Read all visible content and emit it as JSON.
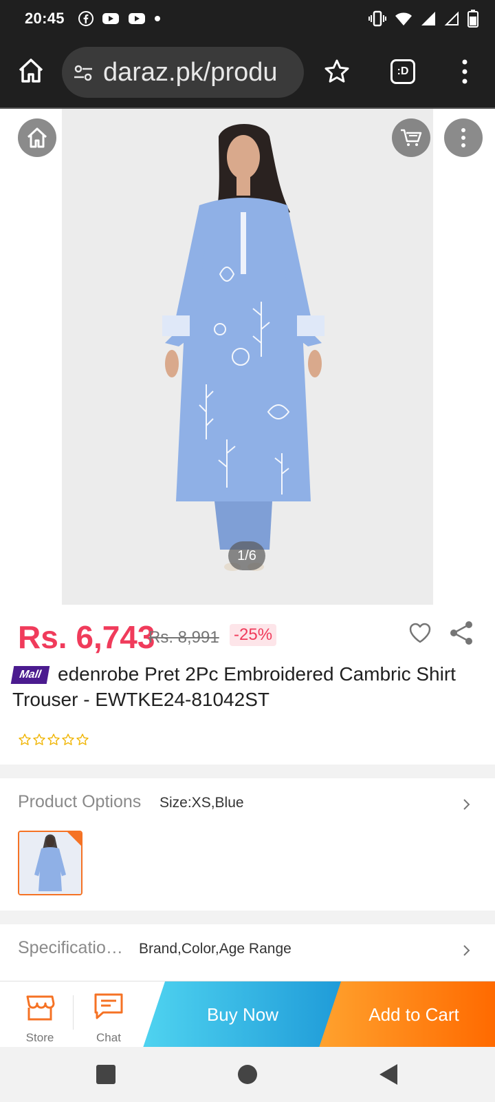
{
  "status_bar": {
    "time": "20:45",
    "left_icons": [
      "facebook-icon",
      "youtube-icon",
      "youtube-icon",
      "dot-icon"
    ],
    "right_icons": [
      "vibrate-icon",
      "wifi-icon",
      "signal-icon",
      "signal-empty-icon",
      "battery-icon"
    ]
  },
  "browser": {
    "url": "daraz.pk/produ",
    "tab_switcher_label": ":D"
  },
  "product_image": {
    "counter": "1/6",
    "colors": {
      "dress": "#8fb0e6",
      "background": "#ececec"
    }
  },
  "price": {
    "current": "Rs. 6,743",
    "original": "Rs. 8,991",
    "discount": "-25%"
  },
  "title": {
    "badge": "Mall",
    "text": "edenrobe Pret 2Pc Embroidered Cambric Shirt Trouser - EWTKE24-81042ST"
  },
  "rating": {
    "stars": 0,
    "max": 5
  },
  "options": {
    "product_options_label": "Product Options",
    "product_options_value": "Size:XS,Blue",
    "specifications_label": "Specificatio…",
    "specifications_value": "Brand,Color,Age Range"
  },
  "bottom_bar": {
    "store_label": "Store",
    "chat_label": "Chat",
    "buy_now_label": "Buy Now",
    "add_to_cart_label": "Add to Cart"
  },
  "colors": {
    "price_red": "#f03b5b",
    "accent_orange": "#f57224",
    "mall_purple": "#4b1b8f",
    "buy_now_blue": "#1f9bd8"
  }
}
